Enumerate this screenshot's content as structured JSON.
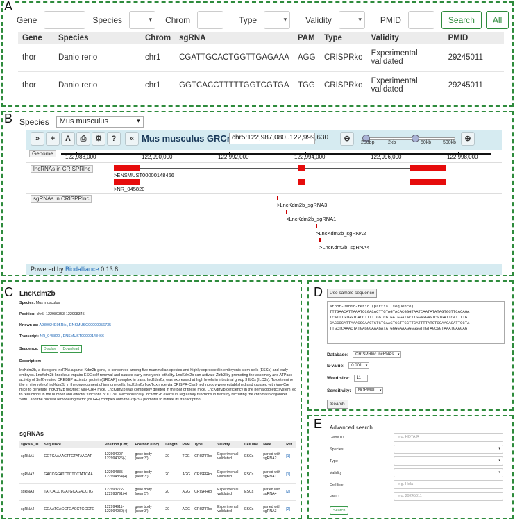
{
  "panel_letters": {
    "a": "A",
    "b": "B",
    "c": "C",
    "d": "D",
    "e": "E"
  },
  "panelA": {
    "search": {
      "gene_label": "Gene",
      "species_label": "Species",
      "chrom_label": "Chrom",
      "type_label": "Type",
      "validity_label": "Validity",
      "pmid_label": "PMID",
      "search_btn": "Search",
      "all_btn": "All"
    },
    "columns": [
      "Gene",
      "Species",
      "Chrom",
      "sgRNA",
      "PAM",
      "Type",
      "Validity",
      "PMID"
    ],
    "rows": [
      {
        "gene": "thor",
        "species": "Danio rerio",
        "chrom": "chr1",
        "sgrna": "CGATTGCACTGGTTGAGAAA",
        "pam": "AGG",
        "type": "CRISPRko",
        "validity1": "Experimental",
        "validity2": "validated",
        "pmid": "29245011"
      },
      {
        "gene": "thor",
        "species": "Danio rerio",
        "chrom": "chr1",
        "sgrna": "GGTCACCTTTTTGGTCGTGA",
        "pam": "TGG",
        "type": "CRISPRko",
        "validity1": "Experimental",
        "validity2": "validated",
        "pmid": "29245011"
      }
    ]
  },
  "panelB": {
    "species_label": "Species",
    "species_value": "Mus musculus",
    "toolbar": {
      "b1": "»",
      "b2": "+",
      "b3": "A",
      "b4": "⎙",
      "b5": "⚙",
      "b6": "?",
      "b7": "«",
      "zoom_out": "⊖",
      "zoom_in": "⊕"
    },
    "genome_title": "Mus musculus GRCm38",
    "location": "chr5:122,987,080..122,999,630",
    "zoom_labels": [
      "200bp",
      "2kb",
      "50kb",
      "500kb"
    ],
    "ruler_ticks": [
      "122,988,000",
      "122,990,000",
      "122,992,000",
      "122,994,000",
      "122,996,000",
      "122,998,000"
    ],
    "tracks": {
      "genome": "Genome",
      "lnc": "lncRNAs in CRISPRlnc",
      "sg": "sgRNAs in CRISPRlnc"
    },
    "transcripts": [
      ">ENSMUST00000148466",
      ">NR_045820"
    ],
    "sgrnas": [
      ">LncKdm2b_sgRNA3",
      "<LncKdm2b_sgRNA1",
      ">LncKdm2b_sgRNA2",
      ">LncKdm2b_sgRNA4"
    ],
    "powered_prefix": "Powered by ",
    "powered_link": "Biodalliance",
    "powered_version": " 0.13.8"
  },
  "panelC": {
    "title": "LncKdm2b",
    "species_k": "Species:",
    "species_v": "Mus musculus",
    "position_k": "Position:",
    "position_v": "chr5: 122989353-122998345",
    "known_k": "Known as:",
    "known_v": "A930024E05Rik , ENSMUSG00000056735",
    "transcript_k": "Transcript:",
    "transcript_v": "NR_045820 , ENSMUST00000148466",
    "sequence_k": "Sequence:",
    "display_btn": "Display",
    "download_btn": "Download",
    "description_k": "Description:",
    "description": "lncKdm2b, a divergent lncRNA against Kdm2b gene, is conserved among five mammalian species and highly expressed in embryonic stem cells (ESCs) and early embryos. LncKdm2b knockout impairs ESC self-renewal and causes early embryonic lethality. LncKdm2b can activate Zbtb3 by promoting the assembly and ATPase activity of Snf2-related CREBBP activator protein (SRCAP) complex in trans. lncKdm2b, was expressed at high levels in intestinal group 3 ILCs (ILC3s). To determine the in vivo role of lncKdm2b in the development of immune cells, lncKdm2b flox/flox mice via CRISPR-Cas9 technology were established and crossed with Vav-Cre mice to generate lncKdm2b flox/flox; Vav-Cre+ mice. LncKdm2b was completely deleted in the BM of these mice. LncKdm2b deficiency in the hematopoietic system led to reductions in the number and effector functions of ILC3s. Mechanistically, lncKdm2b exerts its regulatory functions in trans by recruiting the chromatin organizer Satb1 and the nuclear remodeling factor (NURF) complex onto the Zfp292 promoter to initiate its transcription.",
    "sgrnas_title": "sgRNAs",
    "columns": [
      "sgRNA_ID",
      "Sequence",
      "Position (Chr)",
      "Position (Lnc)",
      "Length",
      "PAM",
      "Type",
      "Validity",
      "Cell line",
      "Note",
      "Ref."
    ],
    "rows": [
      {
        "id": "sgRNA1",
        "seq": "GGTCAAAACTTGTATAAGAT",
        "pos1": "122994007-",
        "pos2": "122994026(-)",
        "lnc1": "gene body",
        "lnc2": "(near 3')",
        "len": "20",
        "pam": "TGG",
        "type": "CRISPRko",
        "val1": "Experimental",
        "val2": "validated",
        "cell": "ESCs",
        "note1": "paried with",
        "note2": "sgRNA2",
        "ref": "[1]"
      },
      {
        "id": "sgRNA2",
        "seq": "GACCGGATCTCTCCTATCAA",
        "pos1": "122994835-",
        "pos2": "122994854(+)",
        "lnc1": "gene body",
        "lnc2": "(near 3')",
        "len": "20",
        "pam": "AGG",
        "type": "CRISPRko",
        "val1": "Experimental",
        "val2": "validated",
        "cell": "ESCs",
        "note1": "paried with",
        "note2": "sgRNA1",
        "ref": "[1]"
      },
      {
        "id": "sgRNA3",
        "seq": "TATCACCTGATGCAGACCTG",
        "pos1": "122993772-",
        "pos2": "122993791(+)",
        "lnc1": "gene body",
        "lnc2": "(near 5')",
        "len": "20",
        "pam": "AGG",
        "type": "CRISPRko",
        "val1": "Experimental",
        "val2": "validated",
        "cell": "ESCs",
        "note1": "paried with",
        "note2": "sgRNA4",
        "ref": "[2]"
      },
      {
        "id": "sgRNA4",
        "seq": "GGAATCAGCTGACCTGGCTG",
        "pos1": "122994911-",
        "pos2": "122994930(+)",
        "lnc1": "gene body",
        "lnc2": "(near 3')",
        "len": "20",
        "pam": "AGG",
        "type": "CRISPRko",
        "val1": "Experimental",
        "val2": "validated",
        "cell": "ESCs",
        "note1": "paried with",
        "note2": "sgRNA3",
        "ref": "[2]"
      }
    ]
  },
  "panelD": {
    "sample_btn": "Use sample sequence",
    "sequence": ">thor-Danio-rerio (partial sequence)\nTTTGAACATTAAATCCGACACTTGTAGTACACGGGTAATCAATATATAGTGGTTCACAGA\nTCATTTGTGGTCACCTTTTTGGTCGTGATGGATACTTGGAGGAGTCGTGATTCATTTTGT\nCACCCCATTAAAGCGAACTGTGTCAAGTCGTTCCTTCATTTTATCTGGAAGAGATTCCTA\nTTGCTCAAACTATGAGGGAAAGATATGGGGAAAGGGGGGTTGTAGCGGTAAATGAAGAG",
    "database_label": "Database:",
    "database_value": "CRISPRlnc lncRNAs",
    "evalue_label": "E-value:",
    "evalue_value": "0.001",
    "wordsize_label": "Word size:",
    "wordsize_value": "11",
    "sensitivity_label": "Sensitivity:",
    "sensitivity_value": "NORMAL",
    "search_btn": "Search"
  },
  "panelE": {
    "title": "Advanced search",
    "fields": [
      {
        "label": "Gene ID",
        "placeholder": "e.g. HOTAIR"
      },
      {
        "label": "Species",
        "placeholder": ""
      },
      {
        "label": "Type",
        "placeholder": ""
      },
      {
        "label": "Validity",
        "placeholder": ""
      },
      {
        "label": "Cell line",
        "placeholder": "e.g. Hela"
      },
      {
        "label": "PMID",
        "placeholder": "e.g. 29245011"
      }
    ],
    "search_btn": "Search"
  }
}
